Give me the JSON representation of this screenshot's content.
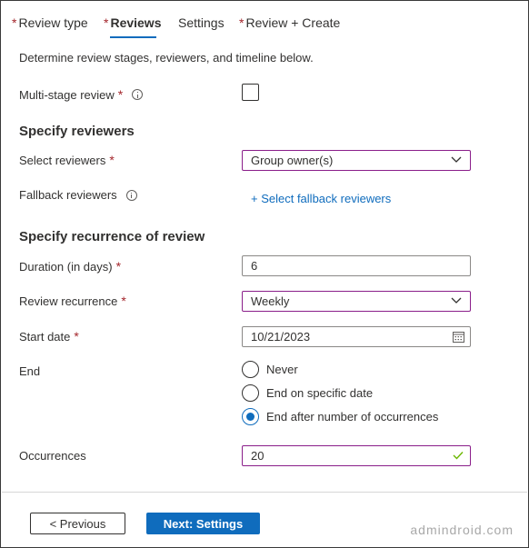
{
  "tabs": {
    "review_type": "Review type",
    "reviews": "Reviews",
    "settings": "Settings",
    "review_create": "Review + Create",
    "required_mark": "*"
  },
  "description": "Determine review stages, reviewers, and timeline below.",
  "multi_stage": {
    "label": "Multi-stage review",
    "required": "*"
  },
  "reviewers_section": {
    "title": "Specify reviewers",
    "select_label": "Select reviewers",
    "select_required": "*",
    "select_value": "Group owner(s)",
    "fallback_label": "Fallback reviewers",
    "fallback_link": "+ Select fallback reviewers"
  },
  "recurrence_section": {
    "title": "Specify recurrence of review",
    "duration_label": "Duration (in days)",
    "duration_required": "*",
    "duration_value": "6",
    "recurrence_label": "Review recurrence",
    "recurrence_required": "*",
    "recurrence_value": "Weekly",
    "start_label": "Start date",
    "start_required": "*",
    "start_value": "10/21/2023",
    "end_label": "End",
    "end_options": [
      "Never",
      "End on specific date",
      "End after number of occurrences"
    ],
    "end_selected": "End after number of occurrences",
    "occurrences_label": "Occurrences",
    "occurrences_value": "20"
  },
  "footer": {
    "previous_label": "< Previous",
    "next_label": "Next: Settings"
  },
  "watermark": "admindroid.com",
  "colors": {
    "accent": "#0f6cbd",
    "required": "#a4262c",
    "focus_border": "#8a1e8a",
    "valid_check": "#6bb700"
  }
}
